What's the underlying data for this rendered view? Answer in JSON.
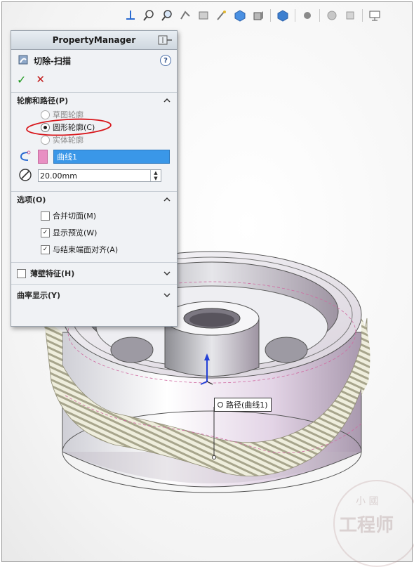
{
  "property_manager": {
    "title": "PropertyManager",
    "feature_name": "切除-扫描",
    "help": "?",
    "ok": "✓",
    "cancel": "✕",
    "profile_section": {
      "label": "轮廓和路径(P)",
      "options": [
        {
          "label": "草图轮廓",
          "selected": false
        },
        {
          "label": "圆形轮廓(C)",
          "selected": true
        },
        {
          "label": "实体轮廓",
          "selected": false
        }
      ],
      "path_value": "曲线1",
      "diameter_value": "20.00mm"
    },
    "options_section": {
      "label": "选项(O)",
      "checks": [
        {
          "label": "合并切面(M)",
          "checked": false
        },
        {
          "label": "显示预览(W)",
          "checked": true
        },
        {
          "label": "与结束端面对齐(A)",
          "checked": true
        }
      ]
    },
    "thin_feature": {
      "label": "薄壁特征(H)",
      "checked": false
    },
    "curvature_display": {
      "label": "曲率显示(Y)"
    }
  },
  "callout": {
    "label": "路径(曲线1)"
  },
  "watermark": {
    "line1": "小 國",
    "line2": "工程师"
  },
  "colors": {
    "selection": "#3a97e8",
    "swatch": "#e88fc3",
    "annotation_red": "#d8161b",
    "ok_green": "#1f9a1f",
    "cancel_red": "#c21a1a"
  }
}
